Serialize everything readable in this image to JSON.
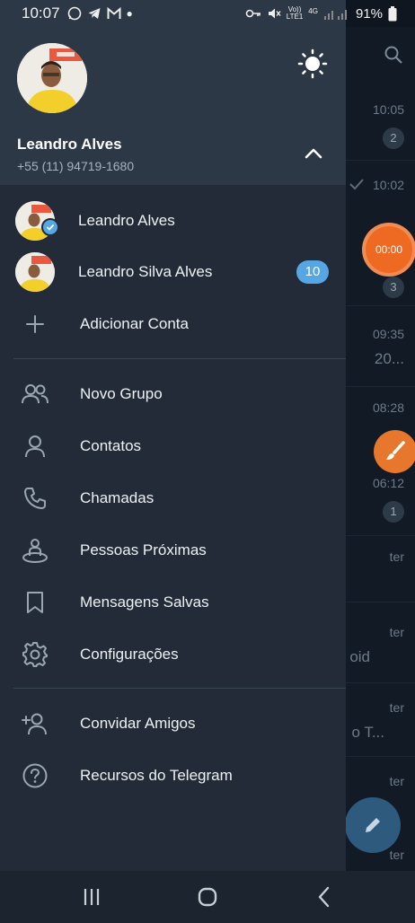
{
  "status_bar": {
    "time": "10:07",
    "signal_label_top": "Vo))",
    "signal_label_bottom": "LTE1",
    "network": "4G",
    "battery": "91%"
  },
  "background_list": {
    "times": [
      "10:05",
      "10:02",
      "09:35",
      "08:28",
      "06:12"
    ],
    "badges": [
      "2",
      "3",
      "1"
    ],
    "snippets": [
      "20...",
      "ter",
      "ter",
      "oid",
      "ter",
      "o T...",
      "ter",
      "ter"
    ],
    "timer": "00:00"
  },
  "drawer": {
    "profile": {
      "name": "Leandro Alves",
      "phone": "+55 (11) 94719-1680"
    },
    "accounts": [
      {
        "name": "Leandro Alves",
        "verified": true
      },
      {
        "name": "Leandro Silva Alves",
        "badge": "10"
      }
    ],
    "add_account": "Adicionar Conta",
    "menu": [
      {
        "label": "Novo Grupo",
        "icon": "group-icon"
      },
      {
        "label": "Contatos",
        "icon": "person-icon"
      },
      {
        "label": "Chamadas",
        "icon": "phone-icon"
      },
      {
        "label": "Pessoas Próximas",
        "icon": "nearby-people-icon"
      },
      {
        "label": "Mensagens Salvas",
        "icon": "bookmark-icon"
      },
      {
        "label": "Configurações",
        "icon": "gear-icon"
      }
    ],
    "secondary_menu": [
      {
        "label": "Convidar Amigos",
        "icon": "add-person-icon"
      },
      {
        "label": "Recursos do Telegram",
        "icon": "help-icon"
      }
    ]
  },
  "colors": {
    "drawer_bg": "#222b37",
    "header_bg": "#2c3846",
    "accent": "#56a6e3",
    "timer": "#ee6a23"
  }
}
